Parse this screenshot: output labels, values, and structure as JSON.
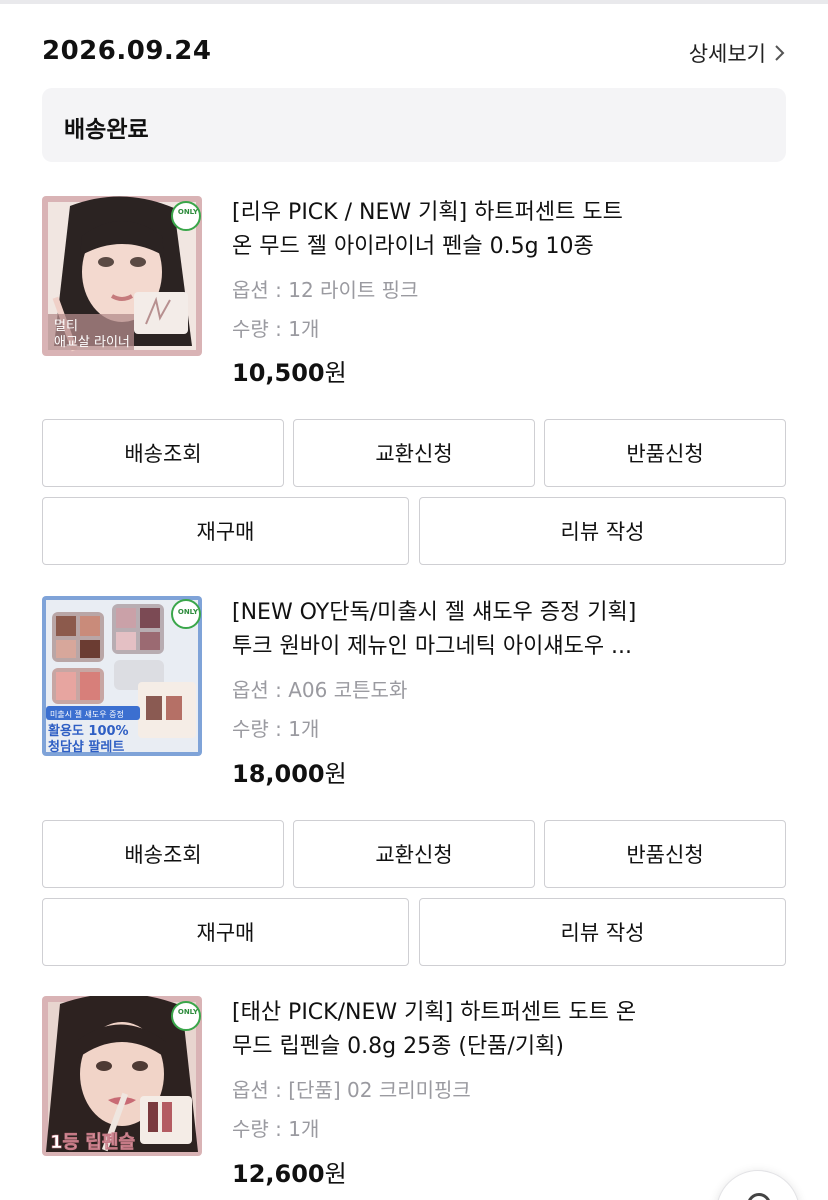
{
  "order": {
    "date": "2026.09.24",
    "detail_link": "상세보기",
    "status": "배송완료"
  },
  "buttons": {
    "track": "배송조회",
    "exchange": "교환신청",
    "return": "반품신청",
    "reorder": "재구매",
    "review": "리뷰 작성"
  },
  "products": [
    {
      "name_line1": "[리우 PICK / NEW 기획] 하트퍼센트 도트",
      "name_line2": "온 무드 젤 아이라이너 펜슬 0.5g 10종",
      "option": "옵션 : 12 라이트 핑크",
      "quantity": "수량 : 1개",
      "price": "10,500",
      "currency": "원",
      "image_badge": "ONLY",
      "image_text": [
        "멀티",
        "애교살 라이너"
      ]
    },
    {
      "name_line1": "[NEW OY단독/미출시 젤 섀도우 증정 기획]",
      "name_line2": "투크 원바이 제뉴인 마그네틱 아이섀도우 ...",
      "option": "옵션 : A06 코튼도화",
      "quantity": "수량 : 1개",
      "price": "18,000",
      "currency": "원",
      "image_badge": "ONLY",
      "image_text": [
        "미출시 젤 섀도우 증정",
        "활용도 100%",
        "청담샵 팔레트"
      ]
    },
    {
      "name_line1": "[태산 PICK/NEW 기획] 하트퍼센트 도트 온",
      "name_line2": "무드 립펜슬 0.8g 25종 (단품/기획)",
      "option": "옵션 : [단품] 02 크리미핑크",
      "quantity": "수량 : 1개",
      "price": "12,600",
      "currency": "원",
      "image_badge": "ONLY",
      "image_text": [
        "1등 립펜슬"
      ]
    }
  ],
  "colors": {
    "status_bg": "#f4f4f6",
    "muted_text": "#9a9aa0",
    "button_border": "#cfcfd3"
  }
}
